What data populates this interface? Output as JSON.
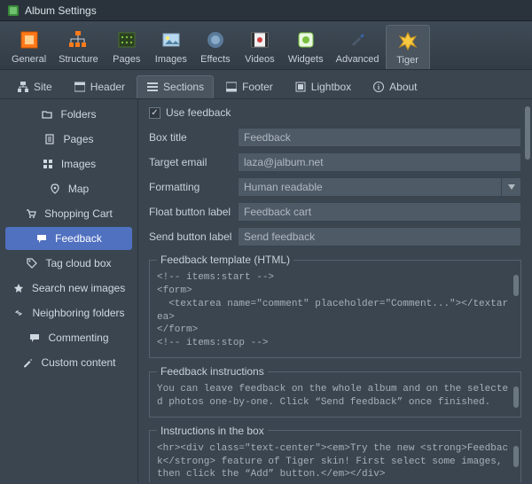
{
  "window": {
    "title": "Album Settings"
  },
  "toolbar": {
    "items": [
      {
        "label": "General",
        "icon": "general"
      },
      {
        "label": "Structure",
        "icon": "structure"
      },
      {
        "label": "Pages",
        "icon": "pages"
      },
      {
        "label": "Images",
        "icon": "images"
      },
      {
        "label": "Effects",
        "icon": "effects"
      },
      {
        "label": "Videos",
        "icon": "videos"
      },
      {
        "label": "Widgets",
        "icon": "widgets"
      },
      {
        "label": "Advanced",
        "icon": "advanced"
      },
      {
        "label": "Tiger",
        "icon": "tiger",
        "selected": true
      }
    ]
  },
  "sub_tabs": {
    "items": [
      {
        "label": "Site",
        "icon": "site"
      },
      {
        "label": "Header",
        "icon": "header"
      },
      {
        "label": "Sections",
        "icon": "sections",
        "selected": true
      },
      {
        "label": "Footer",
        "icon": "footer"
      },
      {
        "label": "Lightbox",
        "icon": "lightbox"
      },
      {
        "label": "About",
        "icon": "about"
      }
    ]
  },
  "sidebar": {
    "items": [
      {
        "label": "Folders",
        "icon": "folder"
      },
      {
        "label": "Pages",
        "icon": "page"
      },
      {
        "label": "Images",
        "icon": "grid"
      },
      {
        "label": "Map",
        "icon": "pin"
      },
      {
        "label": "Shopping Cart",
        "icon": "cart"
      },
      {
        "label": "Feedback",
        "icon": "chat",
        "selected": true
      },
      {
        "label": "Tag cloud box",
        "icon": "tag"
      },
      {
        "label": "Search new images",
        "icon": "star"
      },
      {
        "label": "Neighboring folders",
        "icon": "link"
      },
      {
        "label": "Commenting",
        "icon": "comment"
      },
      {
        "label": "Custom content",
        "icon": "pencil"
      }
    ]
  },
  "form": {
    "use_feedback_label": "Use feedback",
    "use_feedback_checked": true,
    "box_title_label": "Box title",
    "box_title_value": "Feedback",
    "target_email_label": "Target email",
    "target_email_value": "laza@jalbum.net",
    "formatting_label": "Formatting",
    "formatting_value": "Human readable",
    "float_button_label": "Float button label",
    "float_button_value": "Feedback cart",
    "send_button_label": "Send button label",
    "send_button_value": "Send feedback",
    "template_legend": "Feedback template (HTML)",
    "template_code": "<!-- items:start -->\n<form>\n  <textarea name=\"comment\" placeholder=\"Comment...\"></textarea>\n</form>\n<!-- items:stop -->",
    "instructions_legend": "Feedback instructions",
    "instructions_text": "You can leave feedback on the whole album and on the selected photos one-by-one. Click “Send feedback” once finished.",
    "box_instructions_legend": "Instructions in the box",
    "box_instructions_code": "<hr><div class=\"text-center\"><em>Try the new <strong>Feedback</strong> feature of Tiger skin! First select some images, then click the “Add” button.</em></div>"
  }
}
